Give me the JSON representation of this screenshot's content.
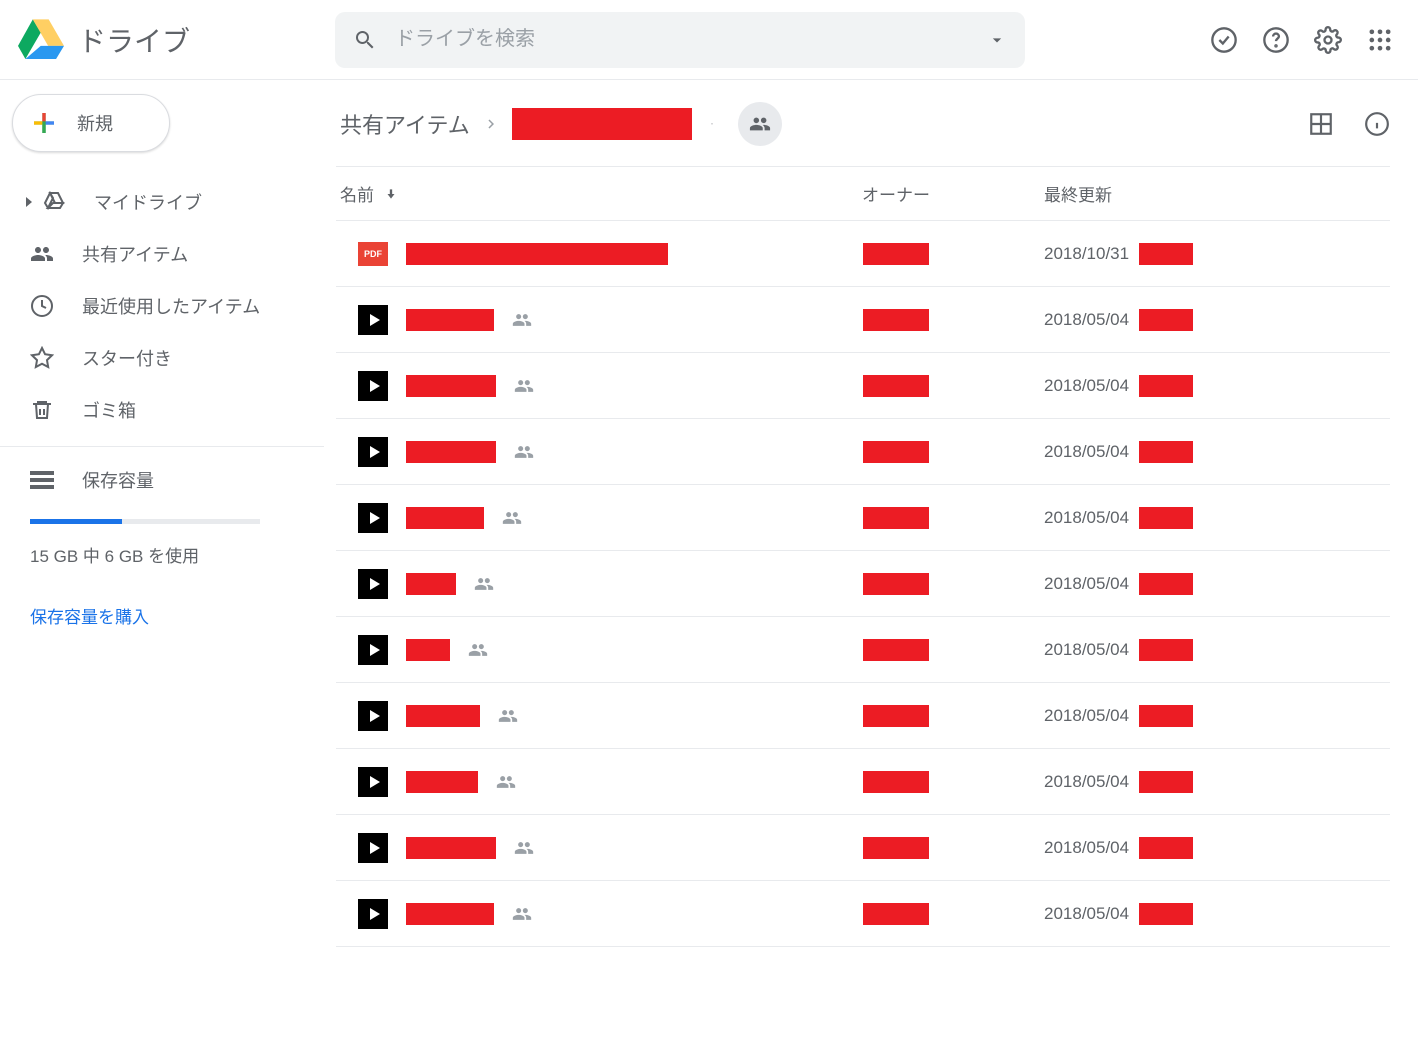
{
  "app": {
    "name": "ドライブ"
  },
  "search": {
    "placeholder": "ドライブを検索"
  },
  "sidebar": {
    "new_label": "新規",
    "items": [
      {
        "label": "マイドライブ",
        "icon": "mydrive",
        "expandable": true
      },
      {
        "label": "共有アイテム",
        "icon": "shared"
      },
      {
        "label": "最近使用したアイテム",
        "icon": "recent"
      },
      {
        "label": "スター付き",
        "icon": "star"
      },
      {
        "label": "ゴミ箱",
        "icon": "trash"
      }
    ],
    "storage": {
      "label": "保存容量",
      "text": "15 GB 中 6 GB を使用",
      "buy_link": "保存容量を購入"
    }
  },
  "breadcrumb": {
    "root": "共有アイテム"
  },
  "columns": {
    "name": "名前",
    "owner": "オーナー",
    "modified": "最終更新"
  },
  "files": [
    {
      "type": "pdf",
      "shared": false,
      "name_width": 262,
      "modified": "2018/10/31"
    },
    {
      "type": "video",
      "shared": true,
      "name_width": 88,
      "modified": "2018/05/04"
    },
    {
      "type": "video",
      "shared": true,
      "name_width": 90,
      "modified": "2018/05/04"
    },
    {
      "type": "video",
      "shared": true,
      "name_width": 90,
      "modified": "2018/05/04"
    },
    {
      "type": "video",
      "shared": true,
      "name_width": 78,
      "modified": "2018/05/04"
    },
    {
      "type": "video",
      "shared": true,
      "name_width": 50,
      "modified": "2018/05/04"
    },
    {
      "type": "video",
      "shared": true,
      "name_width": 44,
      "modified": "2018/05/04"
    },
    {
      "type": "video",
      "shared": true,
      "name_width": 74,
      "modified": "2018/05/04"
    },
    {
      "type": "video",
      "shared": true,
      "name_width": 72,
      "modified": "2018/05/04"
    },
    {
      "type": "video",
      "shared": true,
      "name_width": 90,
      "modified": "2018/05/04"
    },
    {
      "type": "video",
      "shared": true,
      "name_width": 88,
      "modified": "2018/05/04"
    }
  ]
}
